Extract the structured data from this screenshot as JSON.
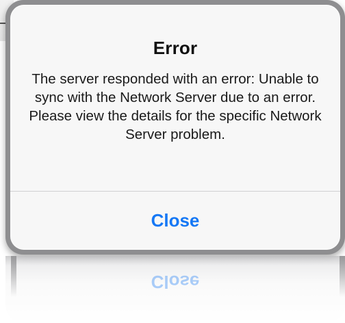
{
  "dialog": {
    "title": "Error",
    "message": "The server responded with an error: Unable to sync with the Network Server due to an error. Please view the details for the specific Network Server problem.",
    "close_label": "Close"
  },
  "reflection": {
    "label": "Close"
  },
  "colors": {
    "accent": "#1578f5",
    "dialog_background": "#f7f7f7",
    "frame": "#8e8e90"
  }
}
